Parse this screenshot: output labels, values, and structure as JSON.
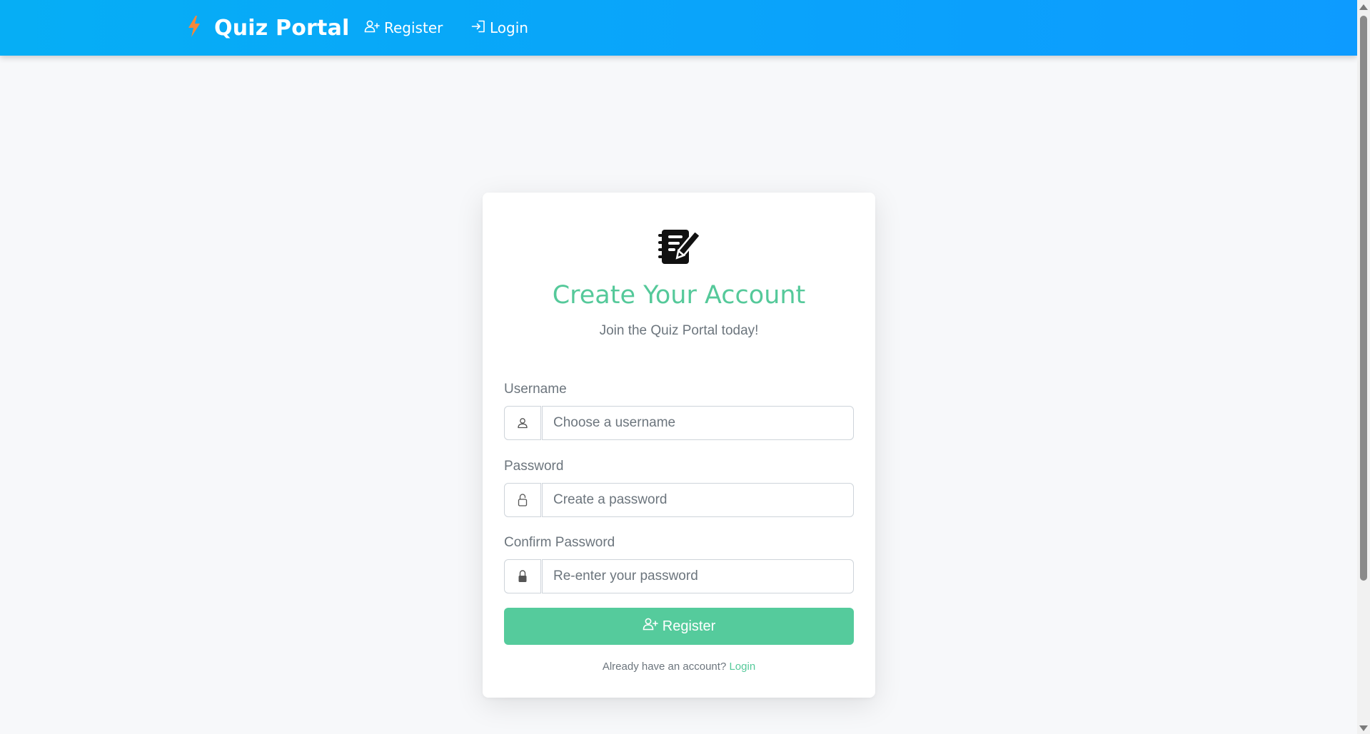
{
  "navbar": {
    "brand": "Quiz Portal",
    "brand_icon": "lightning-bolt-icon",
    "links": [
      {
        "label": "Register",
        "icon": "user-plus-icon"
      },
      {
        "label": "Login",
        "icon": "sign-in-icon"
      }
    ],
    "colors": {
      "gradient_start": "#06aef5",
      "gradient_end": "#0d9bff",
      "bolt": "#f5883a"
    }
  },
  "card": {
    "icon": "notebook-pen-icon",
    "title": "Create Your Account",
    "subtitle": "Join the Quiz Portal today!",
    "fields": {
      "username": {
        "label": "Username",
        "placeholder": "Choose a username",
        "value": "",
        "icon": "user-icon"
      },
      "password": {
        "label": "Password",
        "placeholder": "Create a password",
        "value": "",
        "icon": "lock-open-icon"
      },
      "confirm_password": {
        "label": "Confirm Password",
        "placeholder": "Re-enter your password",
        "value": "",
        "icon": "lock-icon"
      }
    },
    "submit_label": "Register",
    "submit_icon": "user-plus-icon",
    "footer": {
      "prompt": "Already have an account?",
      "link": "Login"
    }
  },
  "colors": {
    "accent": "#55c99a",
    "page_bg": "#f7f8fa",
    "muted_text": "#6c757d"
  }
}
